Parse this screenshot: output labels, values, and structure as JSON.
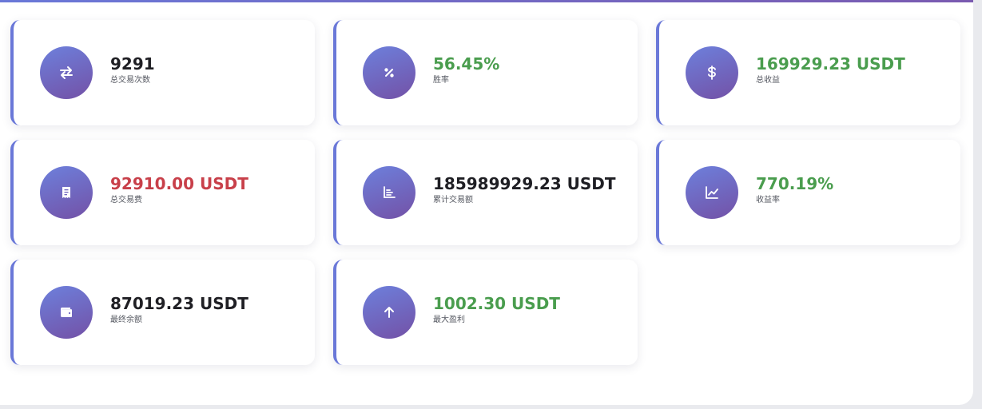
{
  "stats": [
    {
      "value": "9291",
      "label": "总交易次数",
      "icon": "exchange-icon",
      "tone": "default"
    },
    {
      "value": "56.45%",
      "label": "胜率",
      "icon": "percent-icon",
      "tone": "green"
    },
    {
      "value": "169929.23 USDT",
      "label": "总收益",
      "icon": "dollar-icon",
      "tone": "green"
    },
    {
      "value": "92910.00 USDT",
      "label": "总交易费",
      "icon": "receipt-icon",
      "tone": "red"
    },
    {
      "value": "185989929.23 USDT",
      "label": "累计交易额",
      "icon": "bar-chart-icon",
      "tone": "default"
    },
    {
      "value": "770.19%",
      "label": "收益率",
      "icon": "line-chart-icon",
      "tone": "green"
    },
    {
      "value": "87019.23 USDT",
      "label": "最终余额",
      "icon": "wallet-icon",
      "tone": "default"
    },
    {
      "value": "1002.30 USDT",
      "label": "最大盈利",
      "icon": "arrow-up-icon",
      "tone": "green"
    }
  ],
  "colors": {
    "accent": "#6a78d8",
    "positive": "#4a9d4e",
    "negative": "#c8404a",
    "text": "#1f1f24"
  }
}
